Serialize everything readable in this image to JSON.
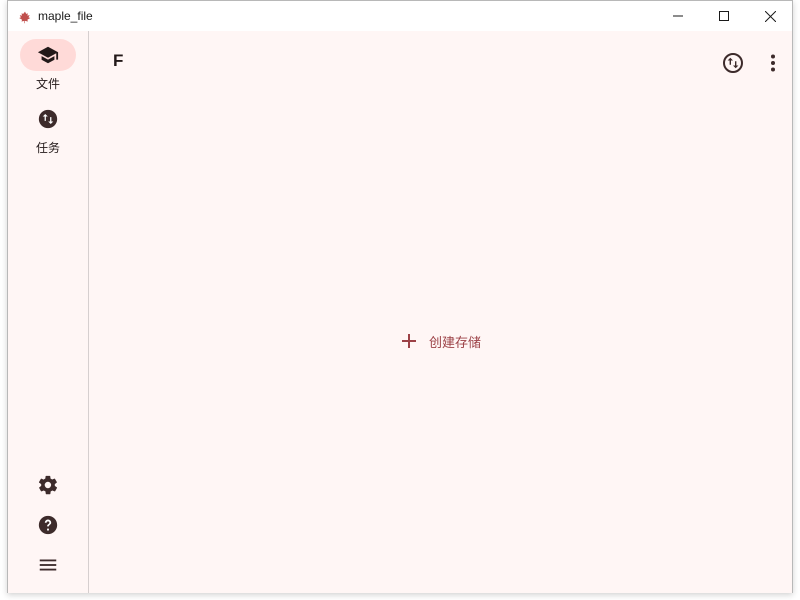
{
  "window": {
    "title": "maple_file",
    "icon": "maple-leaf-icon",
    "controls": [
      "minimize-icon",
      "maximize-icon",
      "close-icon"
    ]
  },
  "rail": {
    "items": [
      {
        "label": "文件",
        "icon": "school-cap-icon",
        "active": true
      },
      {
        "label": "任务",
        "icon": "swap-vertical-circle-icon",
        "active": false
      }
    ],
    "bottom_icons": [
      "settings-gear-icon",
      "help-circle-icon",
      "hamburger-menu-icon"
    ]
  },
  "main": {
    "title": "F",
    "actions": [
      "swap-vertical-circle-outline-icon",
      "more-vert-icon"
    ],
    "empty_state": {
      "button_label": "创建存储",
      "icon": "plus-icon"
    }
  },
  "colors": {
    "background": "#fff6f5",
    "active_pill": "#ffdad8",
    "accent": "#9c4146",
    "icon": "#3d2b2b"
  }
}
